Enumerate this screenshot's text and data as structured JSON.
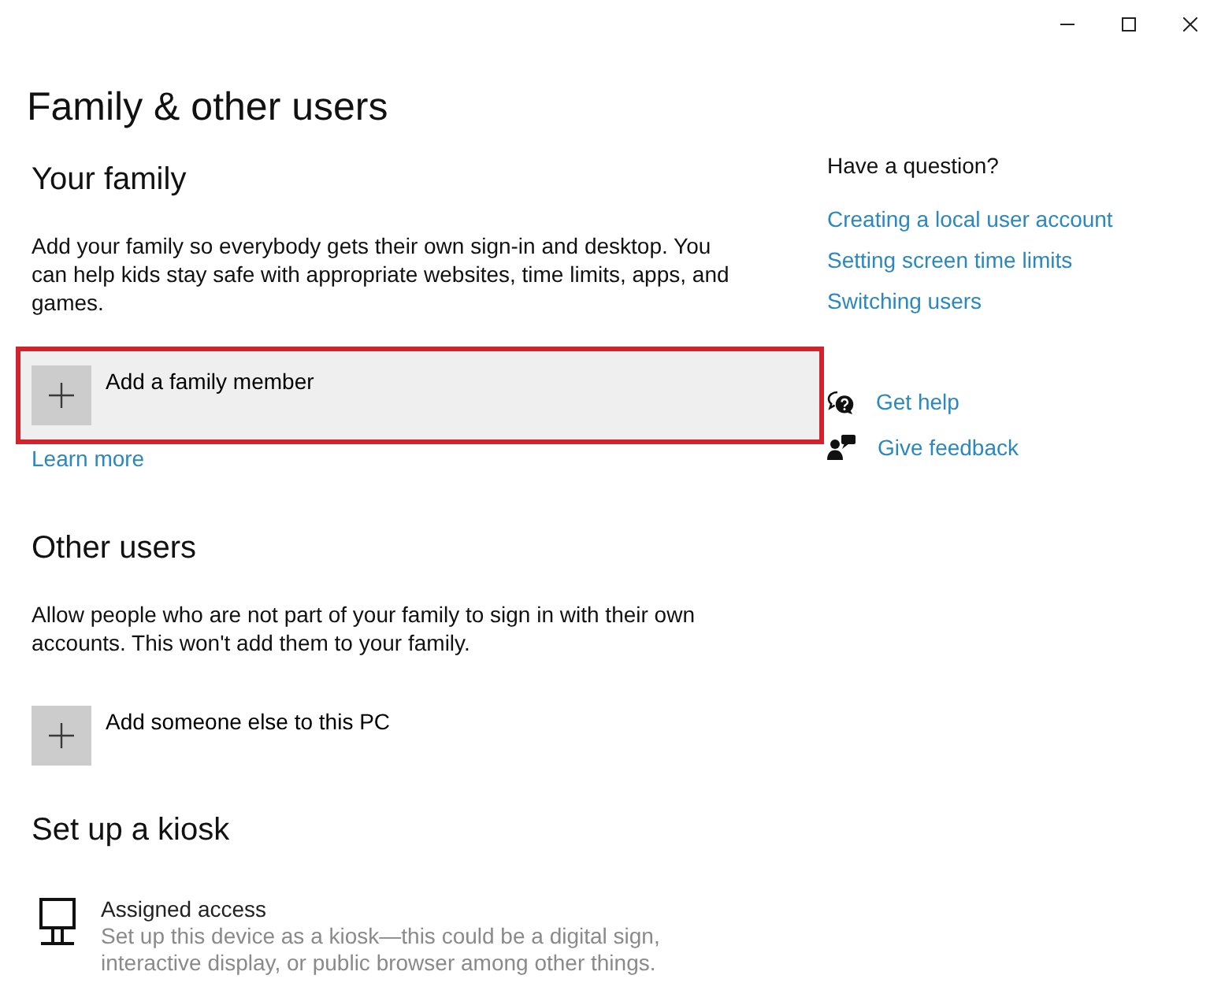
{
  "page": {
    "title": "Family & other users"
  },
  "sections": [
    {
      "heading": "Your family",
      "description": "Add your family so everybody gets their own sign-in and desktop. You can help kids stay safe with appropriate websites, time limits, apps, and games.",
      "actions": [
        {
          "kind": "add",
          "label": "Add a family member",
          "highlighted": true
        }
      ],
      "link": "Learn more"
    },
    {
      "heading": "Other users",
      "description": "Allow people who are not part of your family to sign in with their own accounts. This won't add them to your family.",
      "actions": [
        {
          "kind": "add",
          "label": "Add someone else to this PC",
          "highlighted": false
        }
      ]
    },
    {
      "heading": "Set up a kiosk",
      "actions": [
        {
          "kind": "kiosk",
          "label": "Assigned access",
          "description": "Set up this device as a kiosk—this could be a digital sign, interactive display, or public browser among other things."
        }
      ]
    }
  ],
  "help": {
    "title": "Have a question?",
    "links": [
      "Creating a local user account",
      "Setting screen time limits",
      "Switching users"
    ],
    "actions": [
      {
        "kind": "help",
        "label": "Get help"
      },
      {
        "kind": "feedback",
        "label": "Give feedback"
      }
    ]
  }
}
